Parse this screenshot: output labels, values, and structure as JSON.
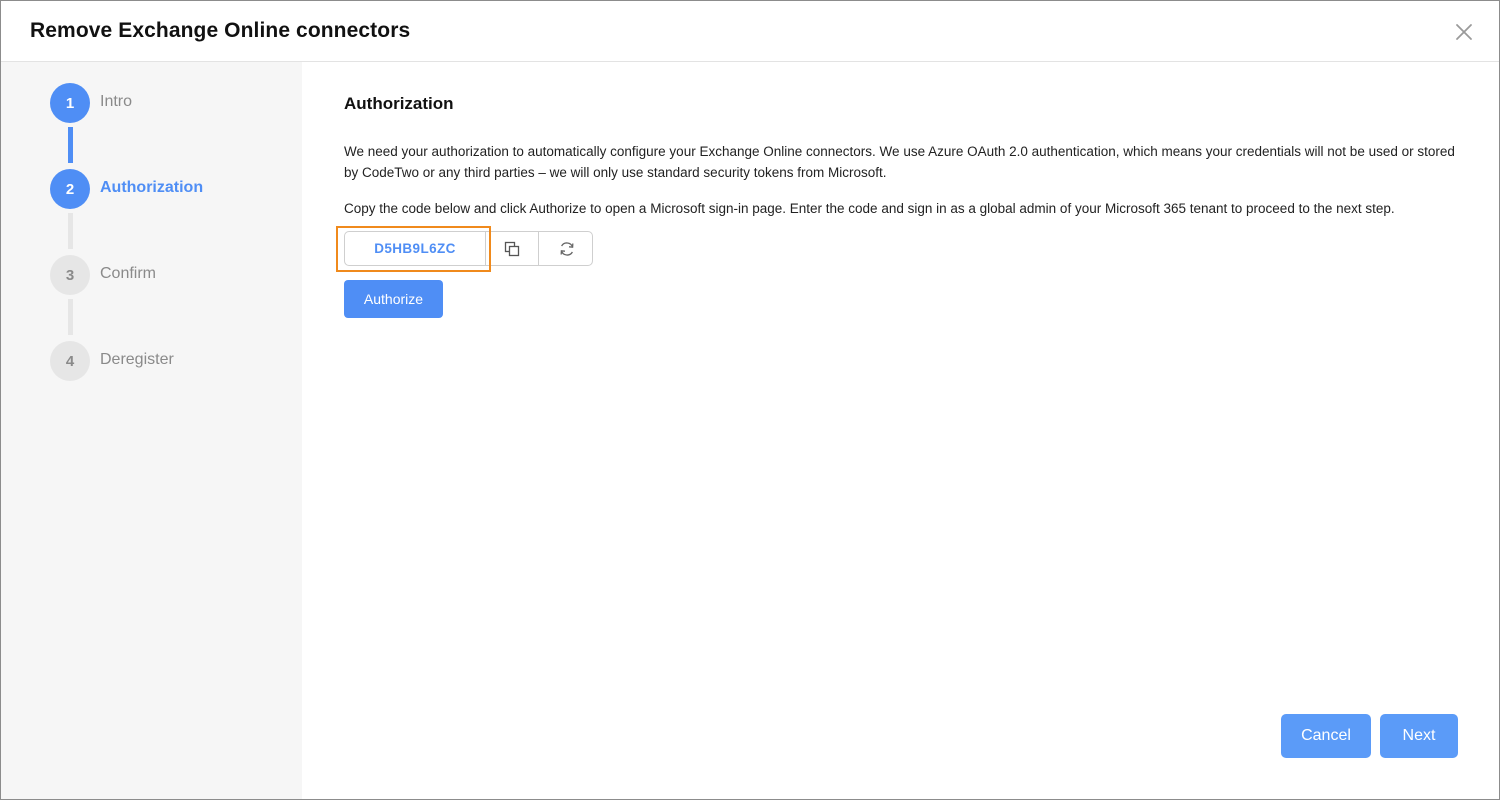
{
  "dialog": {
    "title": "Remove Exchange Online connectors",
    "close_icon": "close-icon"
  },
  "steps": [
    {
      "number": "1",
      "label": "Intro",
      "state": "done"
    },
    {
      "number": "2",
      "label": "Authorization",
      "state": "current"
    },
    {
      "number": "3",
      "label": "Confirm",
      "state": "pending"
    },
    {
      "number": "4",
      "label": "Deregister",
      "state": "pending"
    }
  ],
  "content": {
    "section_title": "Authorization",
    "paragraph1": "We need your authorization to automatically configure your Exchange Online connectors. We use Azure OAuth 2.0 authentication, which means your credentials will not be used or stored by CodeTwo or any third parties – we will only use standard security tokens from Microsoft.",
    "paragraph2": "Copy the code below and click Authorize to open a Microsoft sign-in page. Enter the code and sign in as a global admin of your Microsoft 365 tenant to proceed to the next step.",
    "code": "D5HB9L6ZC",
    "copy_icon": "copy-icon",
    "refresh_icon": "refresh-icon",
    "authorize_label": "Authorize"
  },
  "footer": {
    "cancel_label": "Cancel",
    "next_label": "Next"
  },
  "colors": {
    "accent": "#4f8ef5",
    "highlight": "#f08a1c",
    "inactive_step": "#e6e6e6",
    "sidebar_bg": "#f6f6f6"
  }
}
